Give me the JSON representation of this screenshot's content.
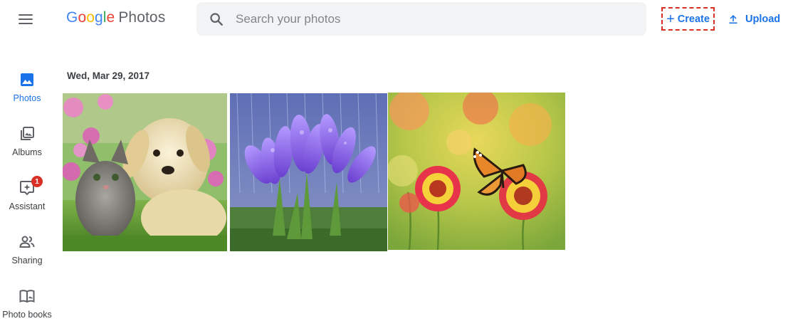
{
  "header": {
    "logo_brand_letters": [
      "G",
      "o",
      "o",
      "g",
      "l",
      "e"
    ],
    "logo_product": "Photos",
    "search_placeholder": "Search your photos",
    "create_label": "Create",
    "upload_label": "Upload",
    "icons": {
      "menu": "menu-icon",
      "search": "search-icon",
      "create": "plus-icon",
      "upload": "upload-icon"
    },
    "colors": {
      "accent": "#1a73e8",
      "highlight_border": "#d93025",
      "search_bg": "#f1f3f4"
    }
  },
  "sidebar": {
    "items": [
      {
        "label": "Photos",
        "icon": "photos-icon",
        "active": true
      },
      {
        "label": "Albums",
        "icon": "albums-icon",
        "active": false
      },
      {
        "label": "Assistant",
        "icon": "assistant-icon",
        "active": false,
        "badge": "1"
      },
      {
        "label": "Sharing",
        "icon": "sharing-icon",
        "active": false
      },
      {
        "label": "Photo books",
        "icon": "photo-books-icon",
        "active": false
      }
    ]
  },
  "main": {
    "date_label": "Wed, Mar 29, 2017",
    "photos": [
      {
        "subject": "puppy-and-kitten"
      },
      {
        "subject": "purple-crocus-flowers"
      },
      {
        "subject": "butterfly-on-flowers"
      }
    ]
  }
}
